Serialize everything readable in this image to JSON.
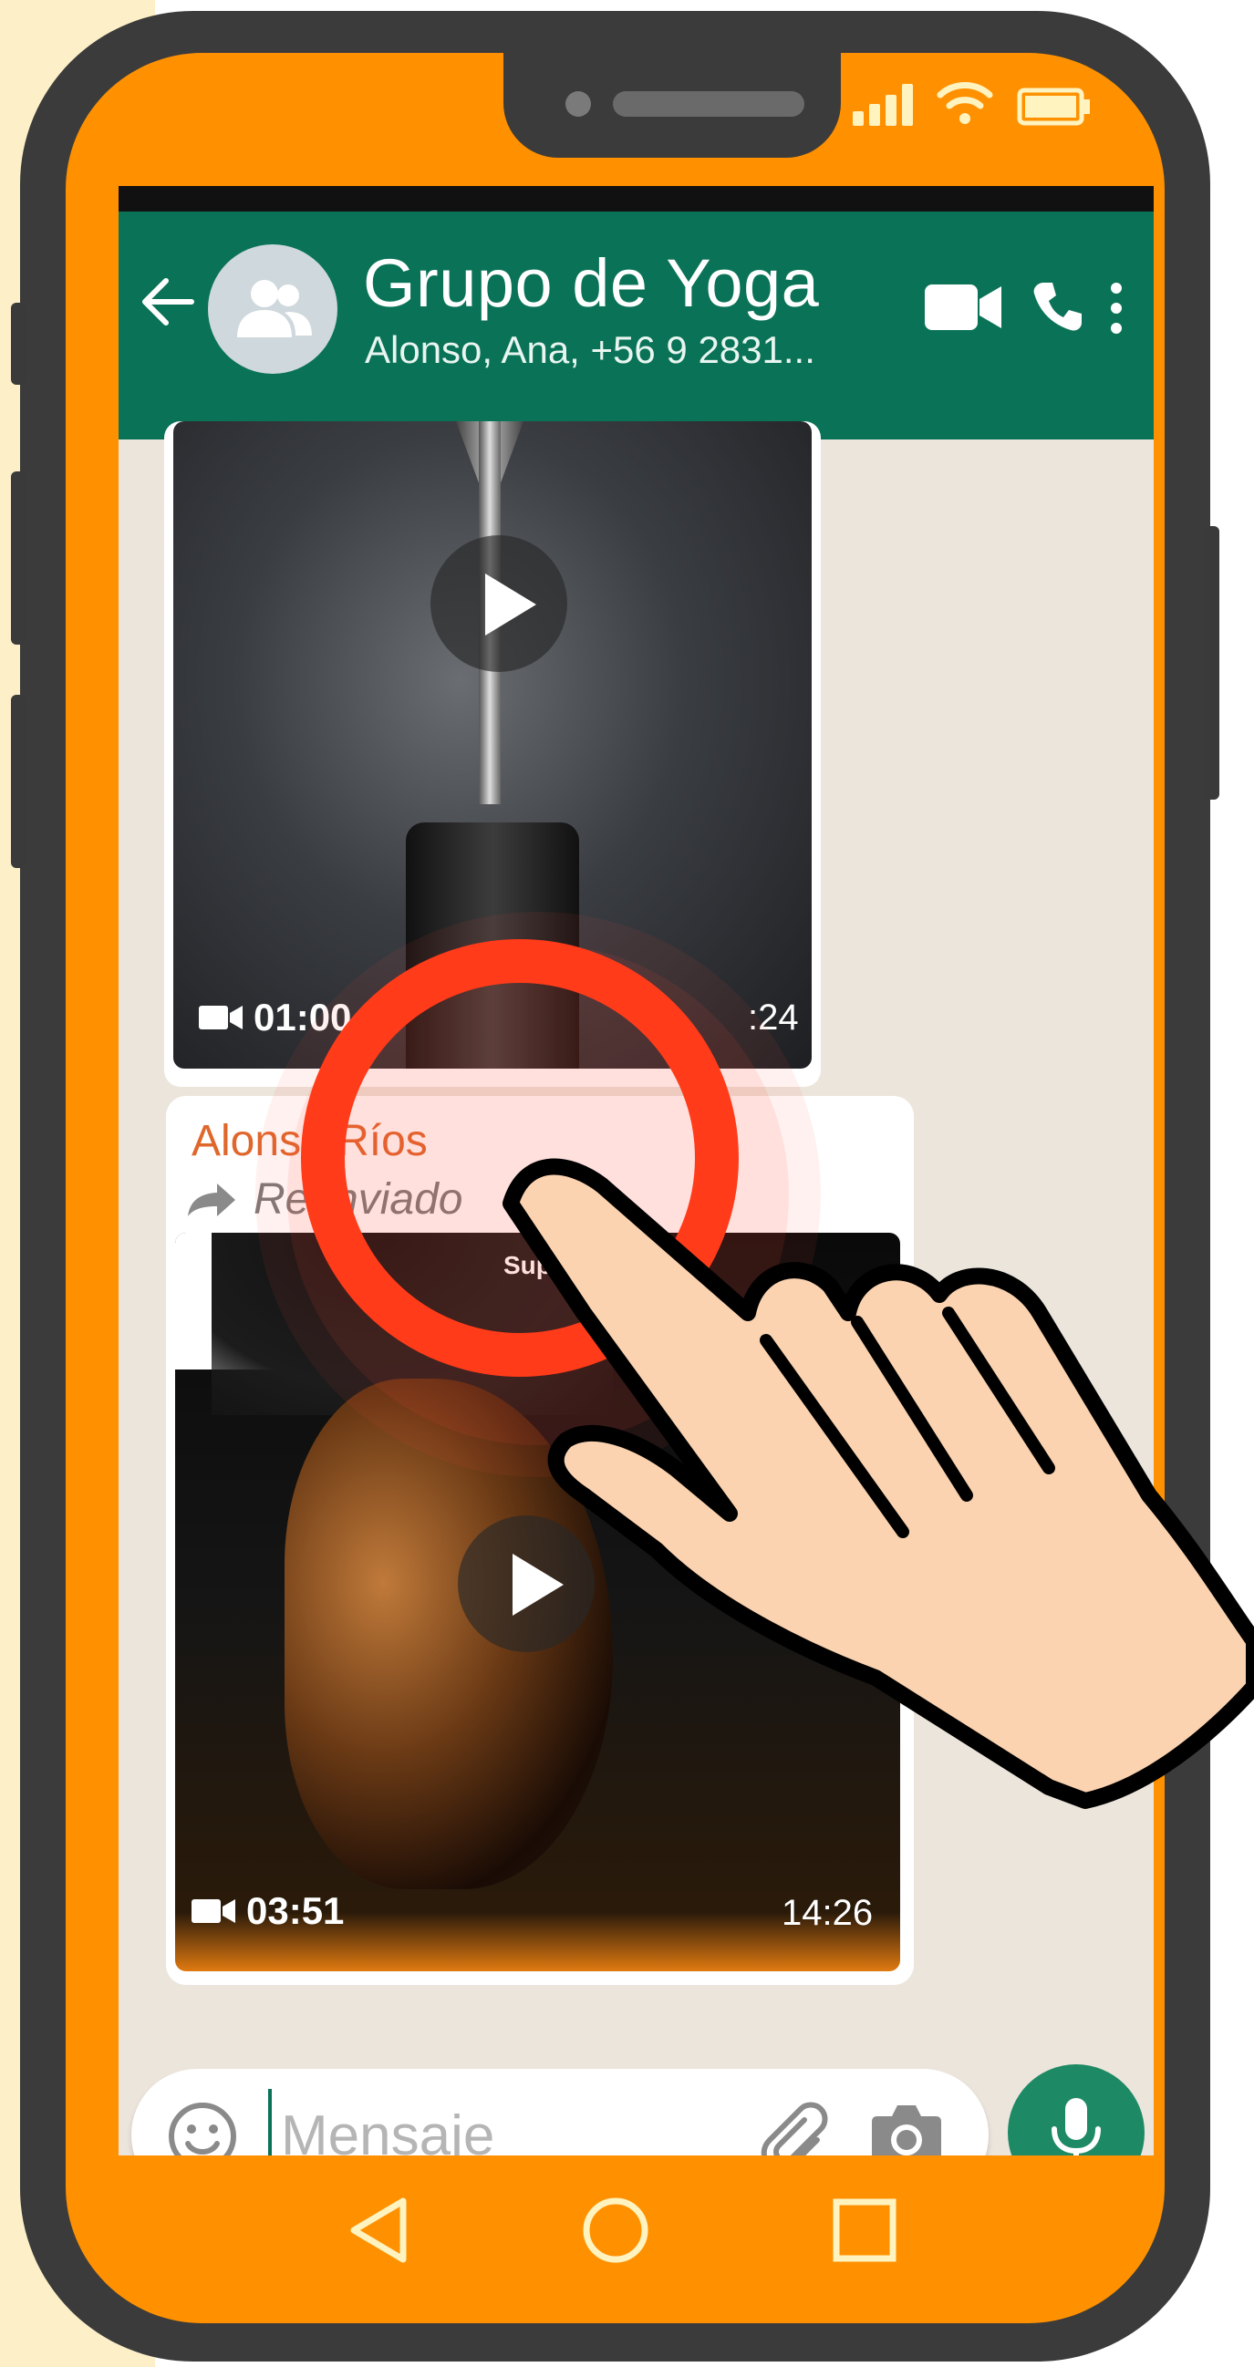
{
  "chat": {
    "title": "Grupo de Yoga",
    "participants": "Alonso, Ana, +56 9 2831..."
  },
  "messages": [
    {
      "type": "video",
      "duration": "01:00",
      "time": ":24"
    },
    {
      "type": "video",
      "sender": "Alonso Ríos",
      "forwarded_label": "Reenviado",
      "overlay_text": "Supe",
      "duration": "03:51",
      "time": "14:26"
    }
  ],
  "composer": {
    "placeholder": "Mensaje"
  },
  "colors": {
    "header": "#0a7357",
    "phone_frame": "#ff9100",
    "sender_name": "#e0672c",
    "mic_button": "#1d8a65",
    "tap_ring": "#ff3b1a",
    "hand_fill": "#fbd3b0"
  },
  "icons": {
    "back": "arrow-left-icon",
    "avatar": "group-icon",
    "video_call": "video-camera-icon",
    "voice_call": "phone-icon",
    "menu": "more-vertical-icon",
    "emoji": "emoji-icon",
    "attach": "paperclip-icon",
    "camera": "camera-icon",
    "mic": "microphone-icon",
    "nav_back": "triangle-back-icon",
    "nav_home": "circle-home-icon",
    "nav_recent": "square-recents-icon"
  }
}
